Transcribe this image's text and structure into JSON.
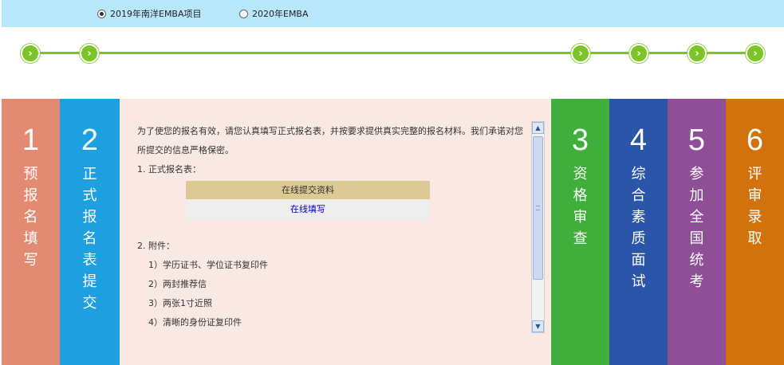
{
  "program_selector": {
    "options": [
      {
        "label": "2019年南洋EMBA项目",
        "checked": true
      },
      {
        "label": "2020年EMBA",
        "checked": false
      }
    ]
  },
  "progress": {
    "arrow_glyph": "›",
    "dot_count": 7,
    "color": "#7cc428"
  },
  "steps": [
    {
      "number": "1",
      "label": "预报名填写",
      "color": "#e38b72"
    },
    {
      "number": "2",
      "label": "正式报名表提交",
      "color": "#1ea0e0"
    },
    {
      "number": "3",
      "label": "资格审查",
      "color": "#3fae3a"
    },
    {
      "number": "4",
      "label": "综合素质面试",
      "color": "#2a55a8"
    },
    {
      "number": "5",
      "label": "参加全国统考",
      "color": "#8e4f96"
    },
    {
      "number": "6",
      "label": "评审录取",
      "color": "#d2720d"
    }
  ],
  "panel": {
    "intro": "为了使您的报名有效，请您认真填写正式报名表，并按要求提供真实完整的报名材料。我们承诺对您所提交的信息严格保密。",
    "section1_title": "1. 正式报名表：",
    "online_table": {
      "header": "在线提交资料",
      "link": "在线填写"
    },
    "section2_title": "2. 附件：",
    "attachments": [
      "1）学历证书、学位证书复印件",
      "2）两封推荐信",
      "3）两张1寸近照",
      "4）清晰的身份证复印件"
    ],
    "background_color": "#fae9e3"
  }
}
